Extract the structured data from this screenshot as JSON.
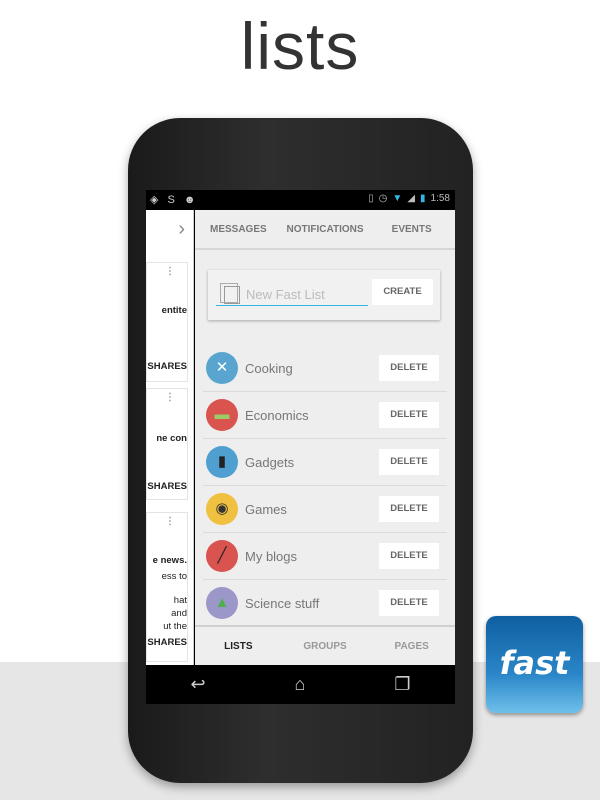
{
  "headline": "lists",
  "status": {
    "time": "1:58",
    "left_icons": [
      "screen-rotation",
      "swiftkey",
      "android-debug"
    ],
    "right_icons": [
      "vibrate",
      "alarm",
      "wifi",
      "signal",
      "battery-charging"
    ]
  },
  "top_tabs": [
    "MESSAGES",
    "NOTIFICATIONS",
    "EVENTS"
  ],
  "new_list": {
    "placeholder": "New Fast List",
    "button": "CREATE"
  },
  "lists": [
    {
      "label": "Cooking",
      "icon": "fork-knife-icon",
      "color": "#5aa5d0",
      "glyph": "✕"
    },
    {
      "label": "Economics",
      "icon": "money-icon",
      "color": "#d9534f",
      "glyph": "▭"
    },
    {
      "label": "Gadgets",
      "icon": "phone-icon",
      "color": "#4f9fd0",
      "glyph": "▯"
    },
    {
      "label": "Games",
      "icon": "gamepad-icon",
      "color": "#f0c040",
      "glyph": "🎮"
    },
    {
      "label": "My blogs",
      "icon": "pen-icon",
      "color": "#d9534f",
      "glyph": "/"
    },
    {
      "label": "Science stuff",
      "icon": "flask-icon",
      "color": "#9b97c8",
      "glyph": "⚗"
    }
  ],
  "delete_label": "DELETE",
  "drawer": {
    "cards": [
      {
        "text": "entite",
        "shares": "SHARES"
      },
      {
        "text": "ne con",
        "shares": "SHARES"
      },
      {
        "text": "e news.",
        "lines": [
          "ess to",
          "hat",
          "and",
          "ut the"
        ],
        "shares": "SHARES"
      }
    ]
  },
  "bottom_tabs": [
    "LISTS",
    "GROUPS",
    "PAGES"
  ],
  "app_icon_label": "fast"
}
